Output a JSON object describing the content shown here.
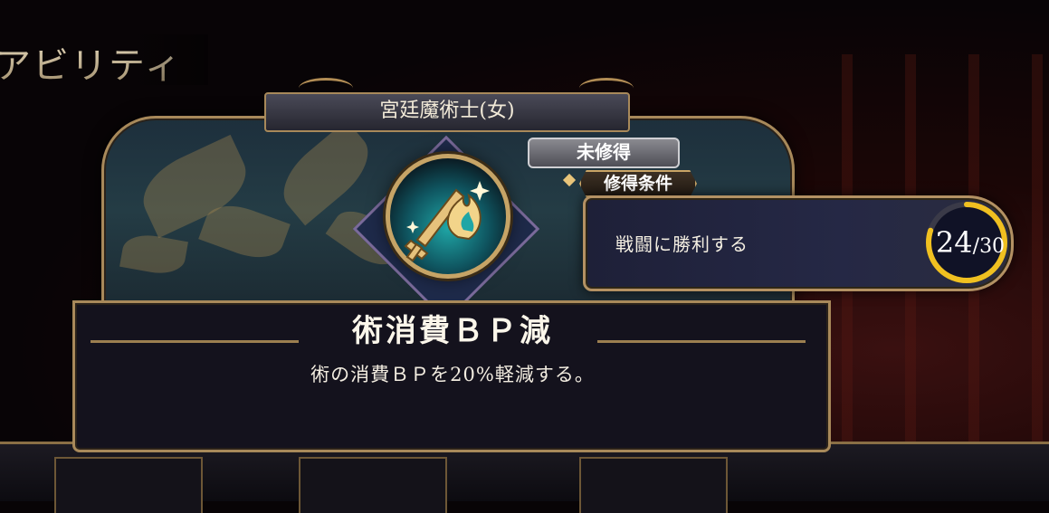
{
  "screen": {
    "title": "アビリティ"
  },
  "ability": {
    "job": "宮廷魔術士(女)",
    "status": "未修得",
    "condition_tag": "修得条件",
    "name": "術消費ＢＰ減",
    "description": "術の消費ＢＰを20%軽減する。"
  },
  "condition": {
    "text": "戦闘に勝利する",
    "current": "24",
    "separator": "/",
    "max": "30",
    "progress": 0.8
  },
  "colors": {
    "gold_frame": "#a8895a",
    "progress_ring": "#f0c020",
    "emblem_teal": "#1fa6a6"
  },
  "icons": {
    "emblem": "sword-and-flame-icon"
  }
}
